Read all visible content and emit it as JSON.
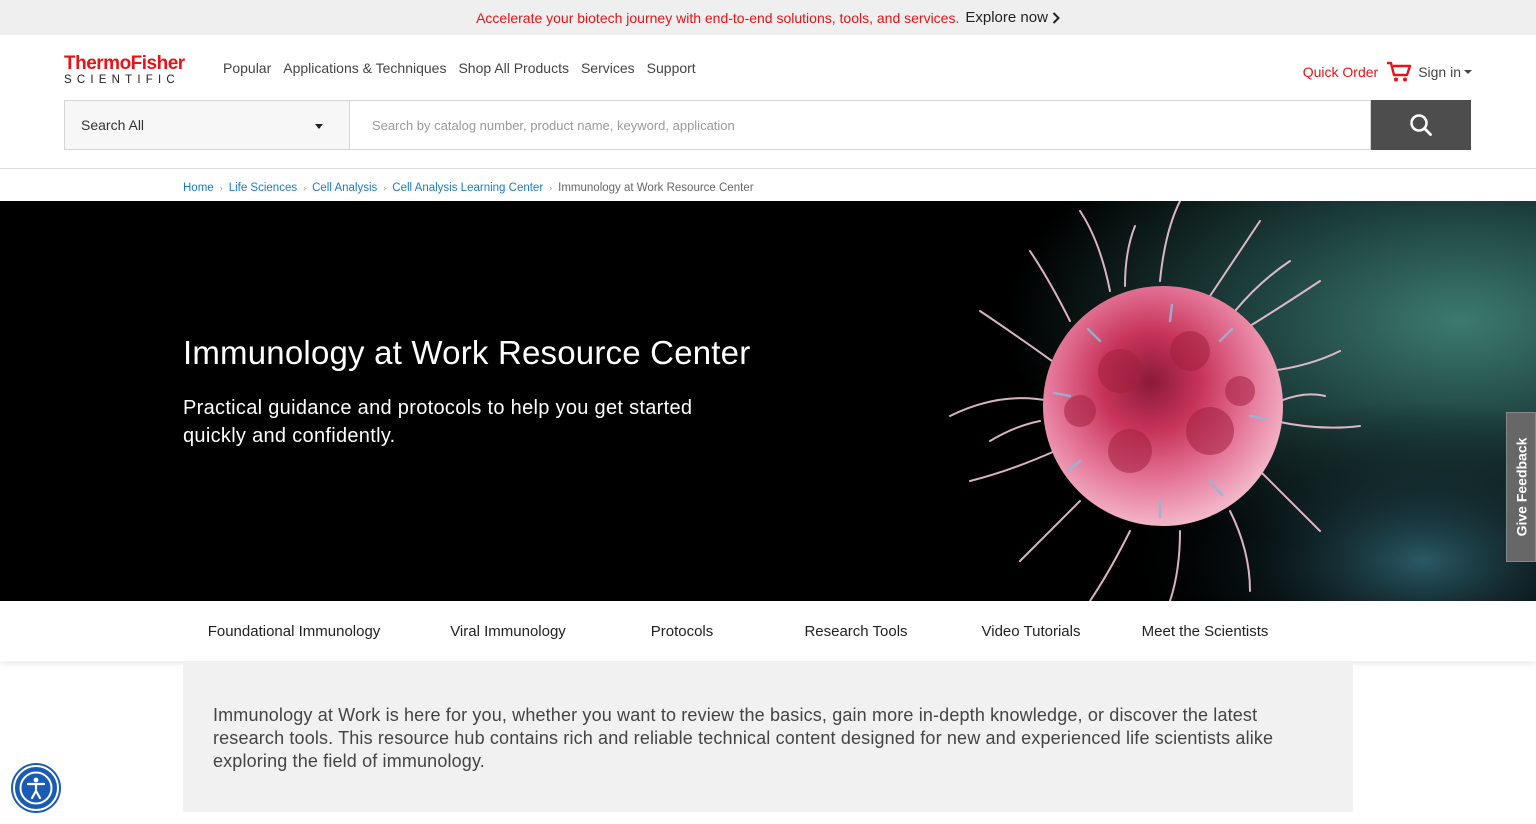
{
  "promo": {
    "text": "Accelerate your biotech journey with end-to-end solutions, tools, and services.",
    "link": "Explore now",
    "accent": "#e71316"
  },
  "header": {
    "logo_top": "ThermoFisher",
    "logo_bottom": "SCIENTIFIC",
    "nav": [
      "Popular",
      "Applications & Techniques",
      "Shop All Products",
      "Services",
      "Support"
    ],
    "quick_order": "Quick Order",
    "sign_in": "Sign in"
  },
  "search": {
    "category": "Search All",
    "placeholder": "Search by catalog number, product name, keyword, application"
  },
  "breadcrumb": {
    "items": [
      "Home",
      "Life Sciences",
      "Cell Analysis",
      "Cell Analysis Learning Center"
    ],
    "current": "Immunology at Work Resource Center"
  },
  "hero": {
    "title": "Immunology at Work Resource Center",
    "subtitle": "Practical guidance and protocols to help you get started quickly and confidently."
  },
  "feedback": "Give Feedback",
  "tabs": [
    "Foundational Immunology",
    "Viral Immunology",
    "Protocols",
    "Research Tools",
    "Video Tutorials",
    "Meet the Scientists"
  ],
  "intro": "Immunology at Work is here for you, whether you want to review the basics, gain more in-depth knowledge, or discover the latest research tools. This resource hub contains rich and reliable technical content designed for new and experienced life scientists alike exploring the field of immunology.",
  "icons": {
    "cart": "cart-icon",
    "search": "search-icon",
    "accessibility": "accessibility-icon",
    "chevron": "chevron-right-icon"
  }
}
